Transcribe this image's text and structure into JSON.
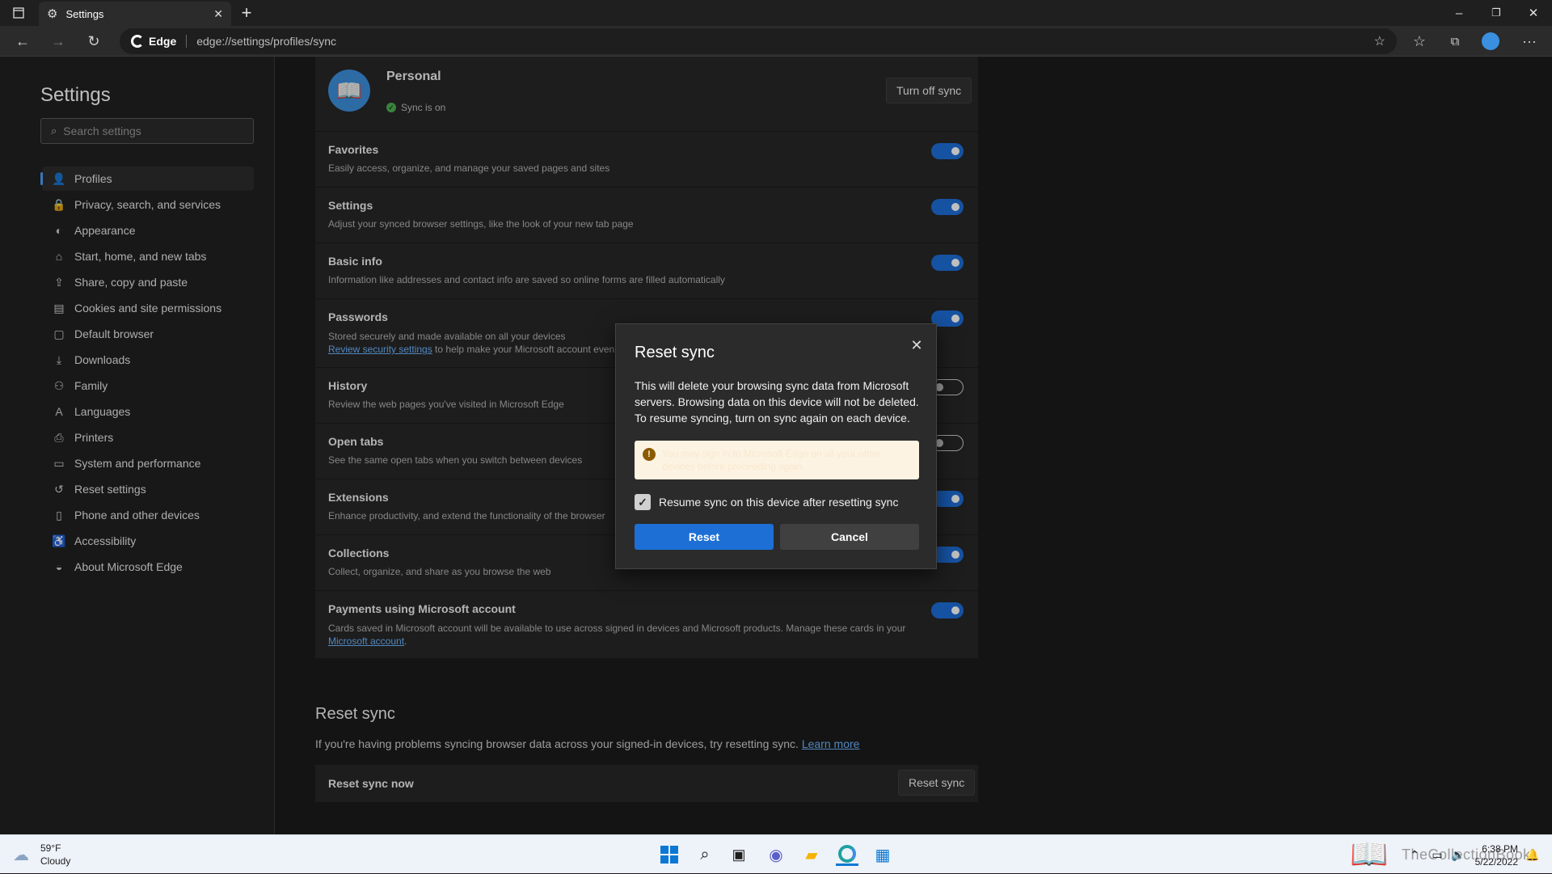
{
  "browser": {
    "tab_title": "Settings",
    "omnibox_brand": "Edge",
    "url": "edge://settings/profiles/sync"
  },
  "sidebar": {
    "title": "Settings",
    "search_placeholder": "Search settings",
    "items": [
      {
        "label": "Profiles",
        "icon": "profile-icon"
      },
      {
        "label": "Privacy, search, and services",
        "icon": "lock-icon"
      },
      {
        "label": "Appearance",
        "icon": "palette-icon"
      },
      {
        "label": "Start, home, and new tabs",
        "icon": "home-icon"
      },
      {
        "label": "Share, copy and paste",
        "icon": "share-icon"
      },
      {
        "label": "Cookies and site permissions",
        "icon": "cookie-icon"
      },
      {
        "label": "Default browser",
        "icon": "browser-icon"
      },
      {
        "label": "Downloads",
        "icon": "download-icon"
      },
      {
        "label": "Family",
        "icon": "family-icon"
      },
      {
        "label": "Languages",
        "icon": "language-icon"
      },
      {
        "label": "Printers",
        "icon": "printer-icon"
      },
      {
        "label": "System and performance",
        "icon": "system-icon"
      },
      {
        "label": "Reset settings",
        "icon": "reset-icon"
      },
      {
        "label": "Phone and other devices",
        "icon": "phone-icon"
      },
      {
        "label": "Accessibility",
        "icon": "accessibility-icon"
      },
      {
        "label": "About Microsoft Edge",
        "icon": "edge-icon"
      }
    ]
  },
  "profile": {
    "name": "Personal",
    "status": "Sync is on",
    "turn_off_label": "Turn off sync"
  },
  "sync_items": [
    {
      "title": "Favorites",
      "desc": "Easily access, organize, and manage your saved pages and sites",
      "on": true
    },
    {
      "title": "Settings",
      "desc": "Adjust your synced browser settings, like the look of your new tab page",
      "on": true
    },
    {
      "title": "Basic info",
      "desc": "Information like addresses and contact info are saved so online forms are filled automatically",
      "on": true
    },
    {
      "title": "Passwords",
      "desc": "Stored securely and made available on all your devices",
      "link": "Review security settings",
      "desc_after_link": " to help make your Microsoft account even",
      "on": true
    },
    {
      "title": "History",
      "desc": "Review the web pages you've visited in Microsoft Edge",
      "on": false
    },
    {
      "title": "Open tabs",
      "desc": "See the same open tabs when you switch between devices",
      "on": false
    },
    {
      "title": "Extensions",
      "desc": "Enhance productivity, and extend the functionality of the browser",
      "on": true
    },
    {
      "title": "Collections",
      "desc": "Collect, organize, and share as you browse the web",
      "on": true
    },
    {
      "title": "Payments using Microsoft account",
      "desc": "Cards saved in Microsoft account will be available to use across signed in devices and Microsoft products. Manage these cards in your",
      "link": "Microsoft account",
      "desc_after_link": ".",
      "on": true
    }
  ],
  "reset_section": {
    "heading": "Reset sync",
    "desc": "If you're having problems syncing browser data across your signed-in devices, try resetting sync.",
    "learn_more": "Learn more",
    "row_label": "Reset sync now",
    "button_label": "Reset sync"
  },
  "dialog": {
    "title": "Reset sync",
    "body": "This will delete your browsing sync data from Microsoft servers. Browsing data on this device will not be deleted. To resume syncing, turn on sync again on each device.",
    "warning": "You may sign in to Microsoft Edge on all your other devices before proceeding again.",
    "checkbox_label": "Resume sync on this device after resetting sync",
    "checkbox_checked": true,
    "reset_label": "Reset",
    "cancel_label": "Cancel"
  },
  "taskbar": {
    "weather_temp": "59°F",
    "weather_desc": "Cloudy",
    "time": "6:38 PM",
    "date": "5/22/2022",
    "watermark": "TheCollectionBook"
  },
  "colors": {
    "accent": "#1d6fd6",
    "toggle_on": "#1e6ed9",
    "sync_ok": "#4caf50"
  }
}
